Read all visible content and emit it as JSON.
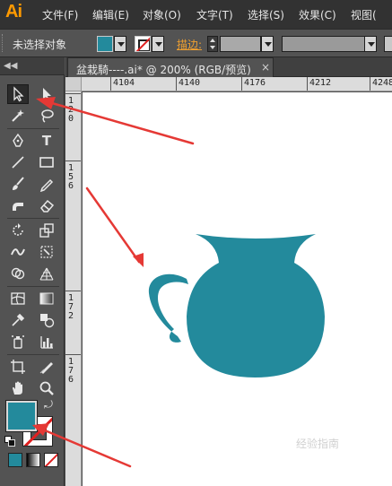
{
  "app": {
    "logo": "Ai",
    "menu": [
      "文件(F)",
      "编辑(E)",
      "对象(O)",
      "文字(T)",
      "选择(S)",
      "效果(C)",
      "视图("
    ]
  },
  "control_bar": {
    "selection_status": "未选择对象",
    "stroke_label": "描边:",
    "fill_color": "#238a9c"
  },
  "document": {
    "tab_title": "盆栽騎----.ai* @ 200% (RGB/预览)",
    "close_glyph": "×"
  },
  "rulers": {
    "horizontal": [
      "4104",
      "4140",
      "4176",
      "4212",
      "4248"
    ],
    "vertical": [
      "1\n2\n0",
      "1\n5\n6",
      "1\n7\n2",
      "1\n7\n6"
    ]
  },
  "tools": {
    "type_glyph": "T",
    "swap_glyph": "⤾",
    "collapse_glyph": "◀◀"
  },
  "artwork": {
    "shape": "vase",
    "color": "#238a9c"
  },
  "annotations": {
    "arrow_color": "#e53935"
  },
  "watermark": "经验指南"
}
